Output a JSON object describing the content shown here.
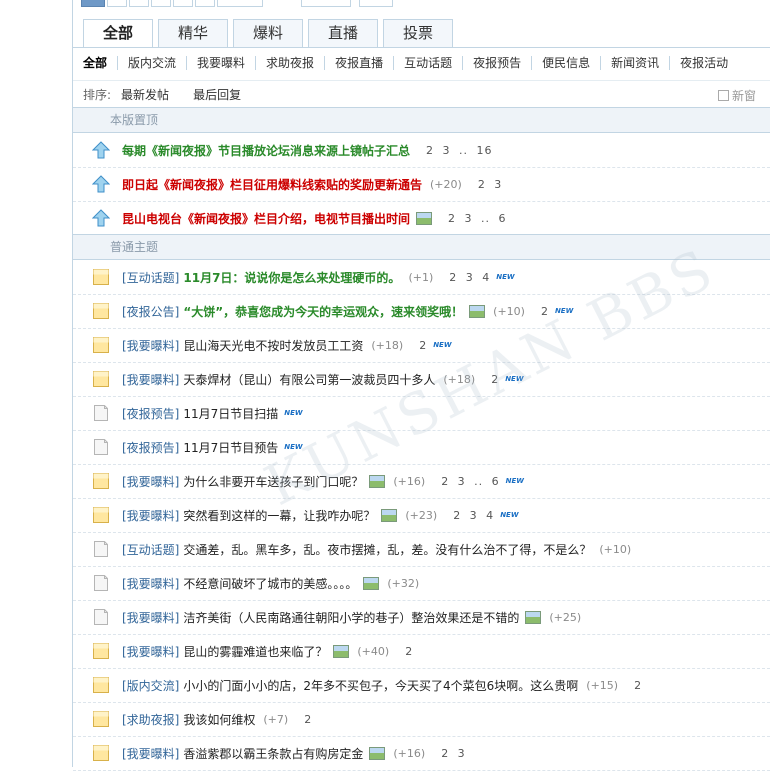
{
  "tabs": [
    "全部",
    "精华",
    "爆料",
    "直播",
    "投票"
  ],
  "categories": [
    "全部",
    "版内交流",
    "我要曝料",
    "求助夜报",
    "夜报直播",
    "互动话题",
    "夜报预告",
    "便民信息",
    "新闻资讯",
    "夜报活动"
  ],
  "sort": {
    "label": "排序:",
    "option1": "最新发帖",
    "option2": "最后回复",
    "new_window": "新窗"
  },
  "section_pinned": "本版置顶",
  "section_normal": "普通主题",
  "pinned": [
    {
      "title": "每期《新闻夜报》节目播放论坛消息来源上镜帖子汇总",
      "color": "green",
      "plus": "",
      "pages": "2 3 .. 16",
      "pic": false
    },
    {
      "title": "即日起《新闻夜报》栏目征用爆料线索贴的奖励更新通告",
      "color": "red",
      "plus": "(+20)",
      "pages": "2 3",
      "pic": false
    },
    {
      "title": "昆山电视台《新闻夜报》栏目介绍，电视节目播出时间",
      "color": "red",
      "plus": "",
      "pages": "2 3 .. 6",
      "pic": true
    }
  ],
  "threads": [
    {
      "tag": "[互动话题]",
      "title": "11月7日：说说你是怎么来处理硬币的。",
      "style": "green-bold",
      "pic": false,
      "plus": "(+1)",
      "pages": "2 3 4",
      "new": "NEW",
      "hot": true
    },
    {
      "tag": "[夜报公告]",
      "title": "“大饼”，恭喜您成为今天的幸运观众，速来领奖哦！",
      "style": "green-bold",
      "pic": true,
      "plus": "(+10)",
      "pages": "2",
      "new": "NEW",
      "hot": true
    },
    {
      "tag": "[我要曝料]",
      "title": "昆山海天光电不按时发放员工工资",
      "style": "",
      "pic": false,
      "plus": "(+18)",
      "pages": "2",
      "new": "NEW",
      "hot": true
    },
    {
      "tag": "[我要曝料]",
      "title": "天泰焊材（昆山）有限公司第一波裁员四十多人",
      "style": "",
      "pic": false,
      "plus": "(+18)",
      "pages": "2",
      "new": "NEW",
      "hot": true
    },
    {
      "tag": "[夜报预告]",
      "title": "11月7日节目扫描",
      "style": "",
      "pic": false,
      "plus": "",
      "pages": "",
      "new": "NEW",
      "hot": false
    },
    {
      "tag": "[夜报预告]",
      "title": "11月7日节目预告",
      "style": "",
      "pic": false,
      "plus": "",
      "pages": "",
      "new": "NEW",
      "hot": false
    },
    {
      "tag": "[我要曝料]",
      "title": "为什么非要开车送孩子到门口呢？",
      "style": "",
      "pic": true,
      "plus": "(+16)",
      "pages": "2 3 .. 6",
      "new": "NEW",
      "hot": true
    },
    {
      "tag": "[我要曝料]",
      "title": "突然看到这样的一幕，让我咋办呢？",
      "style": "",
      "pic": true,
      "plus": "(+23)",
      "pages": "2 3 4",
      "new": "NEW",
      "hot": true
    },
    {
      "tag": "[互动话题]",
      "title": "交通差，乱。黑车多，乱。夜市摆摊，乱，差。没有什么治不了得，不是么？",
      "style": "",
      "pic": false,
      "plus": "(+10)",
      "pages": "",
      "new": "",
      "hot": false
    },
    {
      "tag": "[我要曝料]",
      "title": "不经意间破坏了城市的美感。。。。",
      "style": "",
      "pic": true,
      "plus": "(+32)",
      "pages": "",
      "new": "",
      "hot": false
    },
    {
      "tag": "[我要曝料]",
      "title": "洁齐美街（人民南路通往朝阳小学的巷子）整治效果还是不错的",
      "style": "",
      "pic": true,
      "plus": "(+25)",
      "pages": "",
      "new": "",
      "hot": false
    },
    {
      "tag": "[我要曝料]",
      "title": "昆山的雾霾难道也来临了？",
      "style": "",
      "pic": true,
      "plus": "(+40)",
      "pages": "2",
      "new": "",
      "hot": true
    },
    {
      "tag": "[版内交流]",
      "title": "小小的门面小小的店，2年多不买包子，今天买了4个菜包6块啊。这么贵啊",
      "style": "",
      "pic": false,
      "plus": "(+15)",
      "pages": "2",
      "new": "",
      "hot": true
    },
    {
      "tag": "[求助夜报]",
      "title": "我该如何维权",
      "style": "",
      "pic": false,
      "plus": "(+7)",
      "pages": "2",
      "new": "",
      "hot": true
    },
    {
      "tag": "[我要曝料]",
      "title": "香溢紫郡以霸王条款占有购房定金",
      "style": "",
      "pic": true,
      "plus": "(+16)",
      "pages": "2 3",
      "new": "",
      "hot": true
    }
  ],
  "colors": {
    "border": "#c2d5e3",
    "tag": "#336699",
    "green": "#2a8a2a",
    "red": "#cc0000"
  },
  "icons": {
    "pinned": "up-arrow-icon",
    "hot": "folder-hot-icon",
    "normal": "document-icon"
  }
}
